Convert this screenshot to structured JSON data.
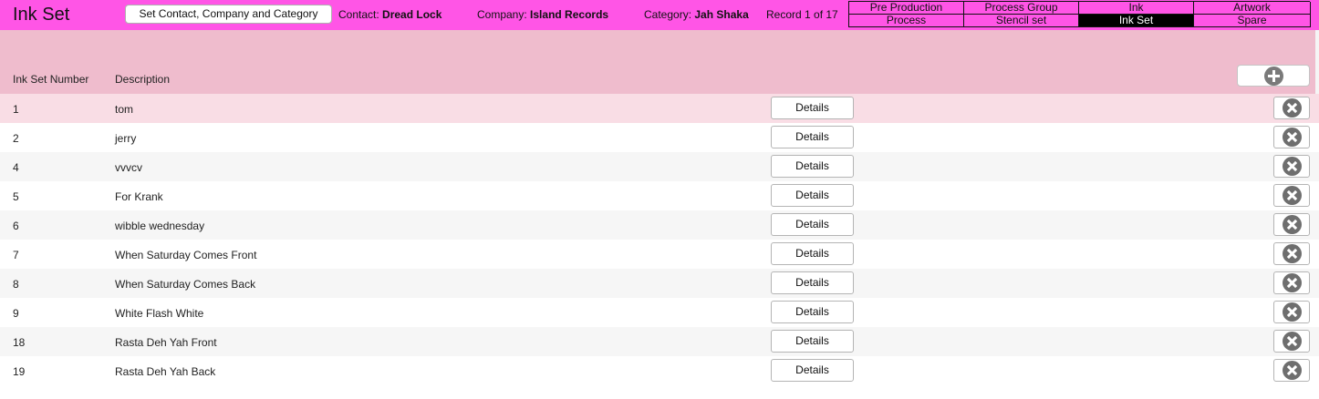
{
  "header": {
    "title": "Ink Set",
    "set_button_label": "Set Contact, Company and Category",
    "contact_label": "Contact:",
    "contact_value": "Dread Lock",
    "company_label": "Company:",
    "company_value": "Island Records",
    "category_label": "Category:",
    "category_value": "Jah Shaka",
    "record_counter": "Record 1 of 17"
  },
  "nav": {
    "items": [
      {
        "label": "Pre Production",
        "active": false
      },
      {
        "label": "Process Group",
        "active": false
      },
      {
        "label": "Ink",
        "active": false
      },
      {
        "label": "Artwork",
        "active": false
      },
      {
        "label": "Process",
        "active": false
      },
      {
        "label": "Stencil set",
        "active": false
      },
      {
        "label": "Ink Set",
        "active": true
      },
      {
        "label": "Spare",
        "active": false
      }
    ]
  },
  "table": {
    "columns": {
      "number": "Ink Set Number",
      "description": "Description"
    },
    "add_icon": "plus-circle-icon",
    "delete_icon": "x-circle-icon",
    "details_label": "Details",
    "rows": [
      {
        "number": "1",
        "description": "tom"
      },
      {
        "number": "2",
        "description": "jerry"
      },
      {
        "number": "4",
        "description": "vvvcv"
      },
      {
        "number": "5",
        "description": "For Krank"
      },
      {
        "number": "6",
        "description": "wibble wednesday"
      },
      {
        "number": "7",
        "description": "When Saturday Comes Front"
      },
      {
        "number": "8",
        "description": "When Saturday Comes Back"
      },
      {
        "number": "9",
        "description": "White Flash White"
      },
      {
        "number": "18",
        "description": "Rasta Deh Yah Front"
      },
      {
        "number": "19",
        "description": "Rasta Deh Yah Back"
      }
    ]
  },
  "colors": {
    "topbar": "#ff55e6",
    "header_band": "#efbccd",
    "selected_row": "#f9dde5",
    "alt_row": "#f6f6f6",
    "active_nav": "#000000"
  }
}
